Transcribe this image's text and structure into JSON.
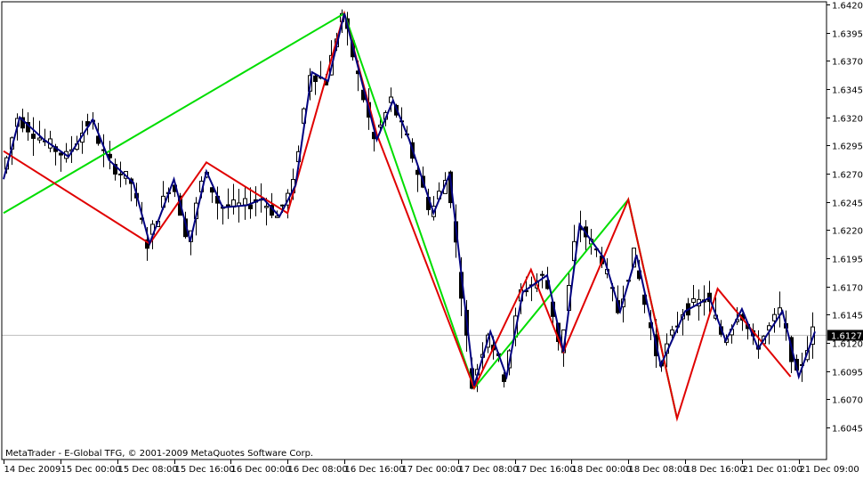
{
  "watermark": "MetaTrader - E-Global TFG, © 2001-2009 MetaQuotes Software Corp.",
  "current_price": "1.6127",
  "colors": {
    "background": "#ffffff",
    "frame": "#000000",
    "candle": "#000000",
    "zigzag_navy": "#000080",
    "zigzag_red": "#e00000",
    "zigzag_green": "#00dd00",
    "price_line": "#c0c0c0",
    "price_tag_bg": "#000000",
    "price_tag_text": "#ffffff"
  },
  "chart_data": {
    "type": "line",
    "title": "",
    "xlabel": "",
    "ylabel": "",
    "grid": false,
    "ylim": [
      1.6035,
      1.642
    ],
    "x_range": [
      0,
      100
    ],
    "x_ticks": [
      {
        "x": 0,
        "label": "14 Dec 2009"
      },
      {
        "x": 7,
        "label": "15 Dec 00:00"
      },
      {
        "x": 14,
        "label": "15 Dec 08:00"
      },
      {
        "x": 21,
        "label": "15 Dec 16:00"
      },
      {
        "x": 28,
        "label": "16 Dec 00:00"
      },
      {
        "x": 35,
        "label": "16 Dec 08:00"
      },
      {
        "x": 42,
        "label": "16 Dec 16:00"
      },
      {
        "x": 49,
        "label": "17 Dec 00:00"
      },
      {
        "x": 56,
        "label": "17 Dec 08:00"
      },
      {
        "x": 63,
        "label": "17 Dec 16:00"
      },
      {
        "x": 70,
        "label": "18 Dec 00:00"
      },
      {
        "x": 77,
        "label": "18 Dec 08:00"
      },
      {
        "x": 84,
        "label": "18 Dec 16:00"
      },
      {
        "x": 91,
        "label": "21 Dec 01:00"
      },
      {
        "x": 98,
        "label": "21 Dec 09:00"
      }
    ],
    "y_ticks": [
      "1.6420",
      "1.6395",
      "1.6370",
      "1.6345",
      "1.6320",
      "1.6295",
      "1.6270",
      "1.6245",
      "1.6220",
      "1.6195",
      "1.6170",
      "1.6145",
      "1.6120",
      "1.6095",
      "1.6070",
      "1.6045"
    ],
    "current_price": 1.6127,
    "series": [],
    "zigzag_navy": [
      [
        0,
        1.6265
      ],
      [
        2,
        1.632
      ],
      [
        5,
        1.63
      ],
      [
        8,
        1.6285
      ],
      [
        11,
        1.6318
      ],
      [
        13,
        1.6282
      ],
      [
        16,
        1.6262
      ],
      [
        18,
        1.6208
      ],
      [
        21,
        1.6265
      ],
      [
        23,
        1.621
      ],
      [
        25,
        1.6272
      ],
      [
        27,
        1.624
      ],
      [
        30,
        1.6242
      ],
      [
        32,
        1.6248
      ],
      [
        34,
        1.6232
      ],
      [
        36,
        1.626
      ],
      [
        38,
        1.636
      ],
      [
        40,
        1.6352
      ],
      [
        42,
        1.6412
      ],
      [
        46,
        1.63
      ],
      [
        48,
        1.6335
      ],
      [
        50,
        1.63
      ],
      [
        53,
        1.6235
      ],
      [
        55,
        1.627
      ],
      [
        58,
        1.6082
      ],
      [
        60,
        1.613
      ],
      [
        62,
        1.609
      ],
      [
        64,
        1.6165
      ],
      [
        67,
        1.618
      ],
      [
        69,
        1.6112
      ],
      [
        71,
        1.6225
      ],
      [
        74,
        1.6195
      ],
      [
        76,
        1.6148
      ],
      [
        78,
        1.6198
      ],
      [
        81,
        1.61
      ],
      [
        84,
        1.6148
      ],
      [
        87,
        1.616
      ],
      [
        89,
        1.6122
      ],
      [
        91,
        1.615
      ],
      [
        93,
        1.6115
      ],
      [
        96,
        1.6148
      ],
      [
        98,
        1.609
      ],
      [
        100,
        1.613
      ]
    ],
    "zigzag_red": [
      [
        0,
        1.629
      ],
      [
        18,
        1.6208
      ],
      [
        25,
        1.628
      ],
      [
        35,
        1.6235
      ],
      [
        42,
        1.6412
      ],
      [
        46,
        1.6305
      ],
      [
        58,
        1.608
      ],
      [
        65,
        1.6185
      ],
      [
        69,
        1.6112
      ],
      [
        77,
        1.6247
      ],
      [
        83,
        1.6053
      ],
      [
        88,
        1.6168
      ],
      [
        97,
        1.609
      ]
    ],
    "zigzag_green": [
      [
        0,
        1.6235
      ],
      [
        42,
        1.6412
      ],
      [
        58,
        1.608
      ],
      [
        77,
        1.6247
      ],
      [
        83,
        1.6053
      ]
    ]
  }
}
